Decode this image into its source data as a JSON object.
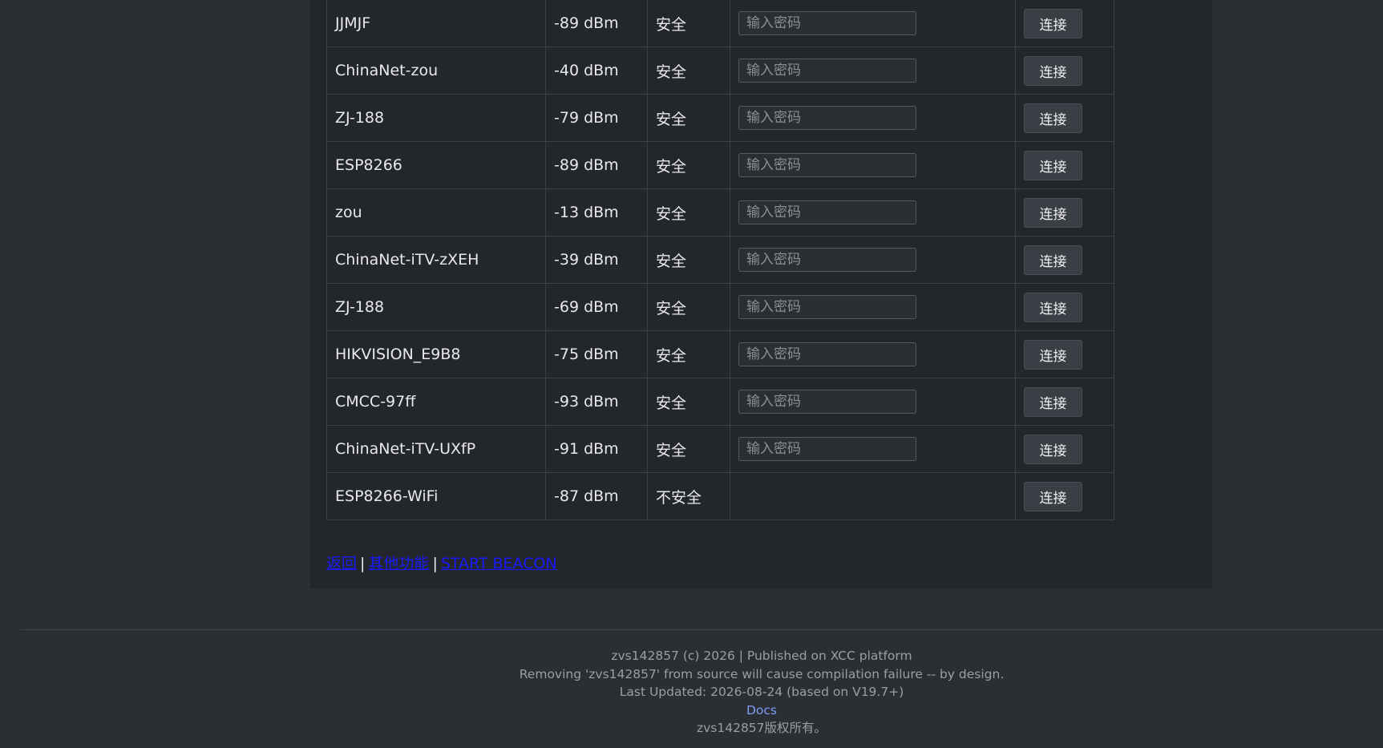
{
  "networks": [
    {
      "ssid": "",
      "rssi": "",
      "security": "",
      "security_level": "secure",
      "placeholder": "输入密码",
      "connect_label": "连接"
    },
    {
      "ssid": "JJMJF",
      "rssi": "-89 dBm",
      "security": "安全",
      "security_level": "secure",
      "placeholder": "输入密码",
      "connect_label": "连接"
    },
    {
      "ssid": "ChinaNet-zou",
      "rssi": "-40 dBm",
      "security": "安全",
      "security_level": "secure",
      "placeholder": "输入密码",
      "connect_label": "连接"
    },
    {
      "ssid": "ZJ-188",
      "rssi": "-79 dBm",
      "security": "安全",
      "security_level": "secure",
      "placeholder": "输入密码",
      "connect_label": "连接"
    },
    {
      "ssid": "ESP8266",
      "rssi": "-89 dBm",
      "security": "安全",
      "security_level": "secure",
      "placeholder": "输入密码",
      "connect_label": "连接"
    },
    {
      "ssid": "zou",
      "rssi": "-13 dBm",
      "security": "安全",
      "security_level": "secure",
      "placeholder": "输入密码",
      "connect_label": "连接"
    },
    {
      "ssid": "ChinaNet-iTV-zXEH",
      "rssi": "-39 dBm",
      "security": "安全",
      "security_level": "secure",
      "placeholder": "输入密码",
      "connect_label": "连接"
    },
    {
      "ssid": "ZJ-188",
      "rssi": "-69 dBm",
      "security": "安全",
      "security_level": "secure",
      "placeholder": "输入密码",
      "connect_label": "连接"
    },
    {
      "ssid": "HIKVISION_E9B8",
      "rssi": "-75 dBm",
      "security": "安全",
      "security_level": "secure",
      "placeholder": "输入密码",
      "connect_label": "连接"
    },
    {
      "ssid": "CMCC-97ff",
      "rssi": "-93 dBm",
      "security": "安全",
      "security_level": "secure",
      "placeholder": "输入密码",
      "connect_label": "连接"
    },
    {
      "ssid": "ChinaNet-iTV-UXfP",
      "rssi": "-91 dBm",
      "security": "安全",
      "security_level": "secure",
      "placeholder": "输入密码",
      "connect_label": "连接"
    },
    {
      "ssid": "ESP8266-WiFi",
      "rssi": "-87 dBm",
      "security": "不安全",
      "security_level": "open",
      "placeholder": "",
      "connect_label": "连接"
    }
  ],
  "colors": {
    "secure": "#f5a623",
    "open": "#3cb371",
    "link": "#1a1aff"
  },
  "links": {
    "back": "返回",
    "other": "其他功能",
    "beacon": "START BEACON",
    "separator": "|"
  },
  "footer": {
    "copyright": "zvs142857 (c) 2026 | Published on XCC platform",
    "warning": "Removing 'zvs142857' from source will cause compilation failure -- by design.",
    "updated": "Last Updated: 2026-08-24 (based on V19.7+)",
    "docs": "Docs",
    "rights": "zvs142857版权所有。"
  }
}
